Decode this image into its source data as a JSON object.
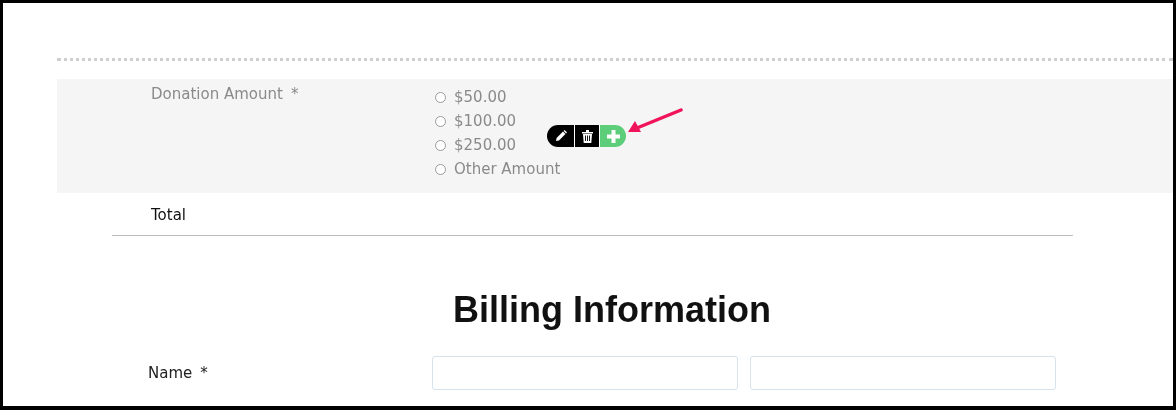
{
  "donation": {
    "label": "Donation Amount",
    "required_mark": "*",
    "options": [
      {
        "label": "$50.00",
        "selected": false
      },
      {
        "label": "$100.00",
        "selected": false
      },
      {
        "label": "$250.00",
        "selected": false
      },
      {
        "label": "Other Amount",
        "selected": false
      }
    ]
  },
  "total": {
    "label": "Total"
  },
  "billing": {
    "heading": "Billing Information",
    "name_label": "Name",
    "required_mark": "*"
  }
}
